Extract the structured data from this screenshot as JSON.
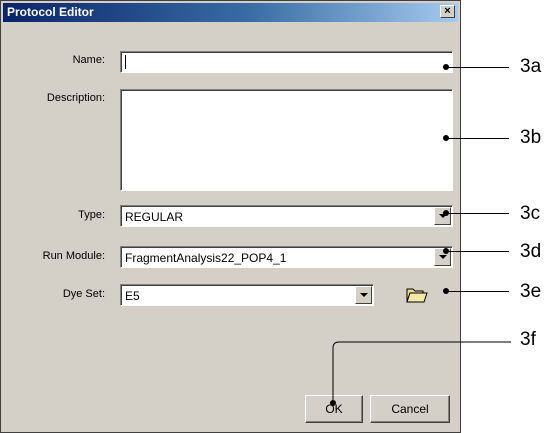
{
  "window": {
    "title": "Protocol Editor",
    "close_glyph": "×"
  },
  "form": {
    "name_label": "Name:",
    "name_value": "",
    "description_label": "Description:",
    "description_value": "",
    "type_label": "Type:",
    "type_value": "REGULAR",
    "run_module_label": "Run Module:",
    "run_module_value": "FragmentAnalysis22_POP4_1",
    "dye_set_label": "Dye Set:",
    "dye_set_value": "E5"
  },
  "buttons": {
    "ok_label": "OK",
    "cancel_label": "Cancel"
  },
  "callouts": [
    "3a",
    "3b",
    "3c",
    "3d",
    "3e",
    "3f"
  ],
  "colors": {
    "titlebar_start": "#0a246a",
    "titlebar_end": "#a6caf0",
    "dialog_bg": "#d4d0c8"
  }
}
